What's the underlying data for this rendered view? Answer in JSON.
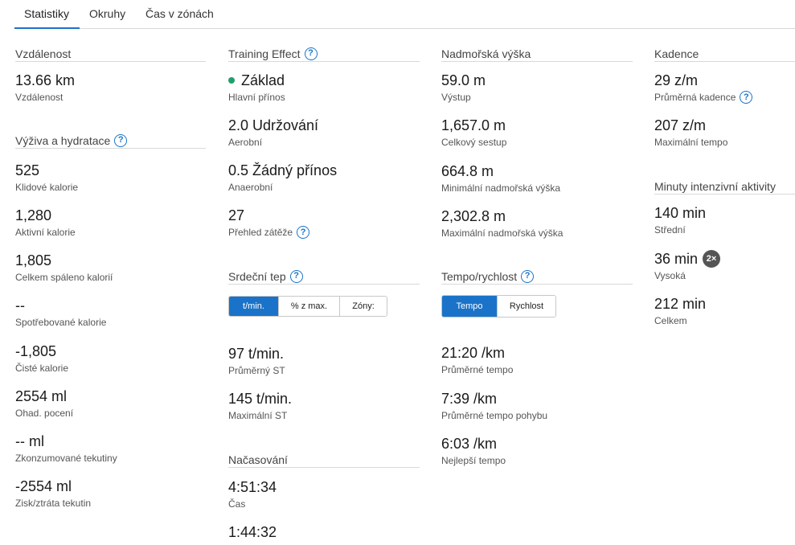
{
  "tabs": [
    "Statistiky",
    "Okruhy",
    "Čas v zónách"
  ],
  "distance": {
    "title": "Vzdálenost",
    "items": [
      {
        "value": "13.66 km",
        "label": "Vzdálenost"
      }
    ]
  },
  "nutrition": {
    "title": "Výživa a hydratace",
    "items": [
      {
        "value": "525",
        "label": "Klidové kalorie"
      },
      {
        "value": "1,280",
        "label": "Aktivní kalorie"
      },
      {
        "value": "1,805",
        "label": "Celkem spáleno kalorií"
      },
      {
        "value": "--",
        "label": "Spotřebované kalorie"
      },
      {
        "value": "-1,805",
        "label": "Čisté kalorie"
      },
      {
        "value": "2554 ml",
        "label": "Ohad. pocení"
      },
      {
        "value": "-- ml",
        "label": "Zkonzumované tekutiny"
      },
      {
        "value": "-2554 ml",
        "label": "Zisk/ztráta tekutin"
      }
    ]
  },
  "training_effect": {
    "title": "Training Effect",
    "items": [
      {
        "value": "Základ",
        "label": "Hlavní přínos"
      },
      {
        "value": "2.0 Udržování",
        "label": "Aerobní"
      },
      {
        "value": "0.5 Žádný přínos",
        "label": "Anaerobní"
      },
      {
        "value": "27",
        "label": "Přehled zátěže"
      }
    ]
  },
  "heart_rate": {
    "title": "Srdeční tep",
    "toggle": [
      "t/min.",
      "% z max.",
      "Zóny:"
    ],
    "items": [
      {
        "value": "97 t/min.",
        "label": "Průměrný ST"
      },
      {
        "value": "145 t/min.",
        "label": "Maximální ST"
      }
    ]
  },
  "timing": {
    "title": "Načasování",
    "items": [
      {
        "value": "4:51:34",
        "label": "Čas"
      },
      {
        "value": "1:44:32",
        "label": ""
      }
    ]
  },
  "elevation": {
    "title": "Nadmořská výška",
    "items": [
      {
        "value": "59.0 m",
        "label": "Výstup"
      },
      {
        "value": "1,657.0 m",
        "label": "Celkový sestup"
      },
      {
        "value": "664.8 m",
        "label": "Minimální nadmořská výška"
      },
      {
        "value": "2,302.8 m",
        "label": "Maximální nadmořská výška"
      }
    ]
  },
  "pace": {
    "title": "Tempo/rychlost",
    "toggle": [
      "Tempo",
      "Rychlost"
    ],
    "items": [
      {
        "value": "21:20 /km",
        "label": "Průměrné tempo"
      },
      {
        "value": "7:39 /km",
        "label": "Průměrné tempo pohybu"
      },
      {
        "value": "6:03 /km",
        "label": "Nejlepší tempo"
      }
    ]
  },
  "cadence": {
    "title": "Kadence",
    "items": [
      {
        "value": "29 z/m",
        "label": "Průměrná kadence"
      },
      {
        "value": "207 z/m",
        "label": "Maximální tempo"
      }
    ]
  },
  "intensity": {
    "title": "Minuty intenzivní aktivity",
    "items": [
      {
        "value": "140 min",
        "label": "Střední"
      },
      {
        "value": "36 min",
        "label": "Vysoká",
        "badge": "2×"
      },
      {
        "value": "212 min",
        "label": "Celkem"
      }
    ]
  },
  "colors": {
    "accent": "#1a73c9",
    "dot": "#1fa06d",
    "badge": "#555555"
  }
}
